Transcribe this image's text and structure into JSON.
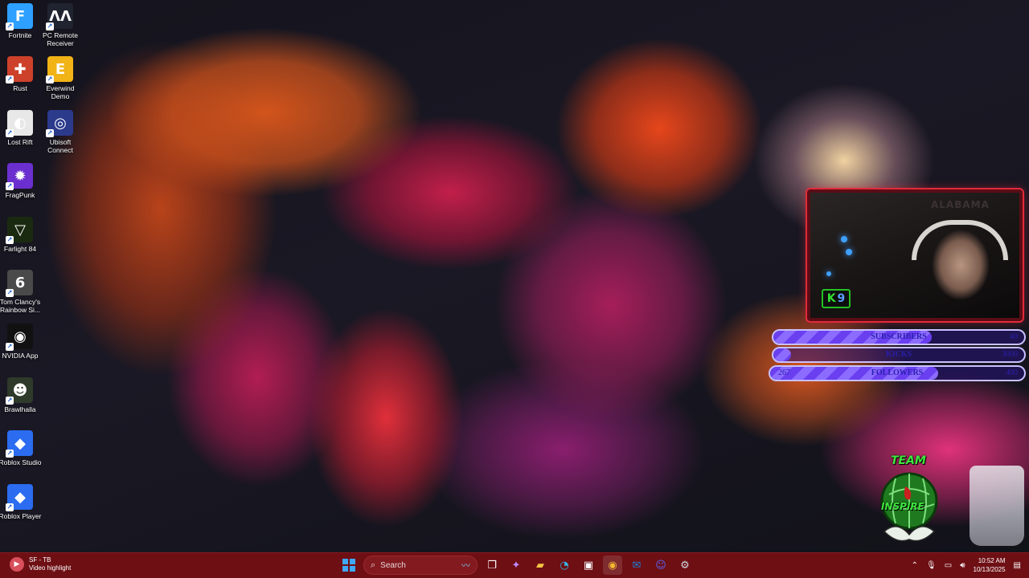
{
  "desktop": {
    "icons": [
      {
        "label": "Fortnite",
        "icon": "fortnite-icon",
        "glyph": "F",
        "color": "#2ea0ff"
      },
      {
        "label": "PC Remote Receiver",
        "icon": "pc-remote-icon",
        "glyph": "ΛΛ",
        "color": "#1f2430"
      },
      {
        "label": "Rust",
        "icon": "rust-icon",
        "glyph": "✚",
        "color": "#cd412b"
      },
      {
        "label": "Everwind Demo",
        "icon": "everwind-icon",
        "glyph": "E",
        "color": "#f1b316"
      },
      {
        "label": "Lost Rift",
        "icon": "lost-rift-icon",
        "glyph": "◐",
        "color": "#e8e8e8"
      },
      {
        "label": "Ubisoft Connect",
        "icon": "ubisoft-icon",
        "glyph": "◎",
        "color": "#2c3a8c"
      },
      {
        "label": "FragPunk",
        "icon": "fragpunk-icon",
        "glyph": "✹",
        "color": "#6b2fcf"
      },
      {
        "label": "Farlight 84",
        "icon": "farlight-icon",
        "glyph": "▽",
        "color": "#1a2a10"
      },
      {
        "label": "Tom Clancy's Rainbow Si...",
        "icon": "rainbow-six-icon",
        "glyph": "6",
        "color": "#4a4a4a"
      },
      {
        "label": "NVIDIA App",
        "icon": "nvidia-icon",
        "glyph": "◉",
        "color": "#111111"
      },
      {
        "label": "Brawlhalla",
        "icon": "brawlhalla-icon",
        "glyph": "☻",
        "color": "#2e3a2a"
      },
      {
        "label": "Roblox Studio",
        "icon": "roblox-studio-icon",
        "glyph": "◆",
        "color": "#2b6cf0"
      },
      {
        "label": "Roblox Player",
        "icon": "roblox-player-icon",
        "glyph": "◆",
        "color": "#2b6cf0"
      }
    ]
  },
  "overlay": {
    "cam_banner": "ALABAMA",
    "badge_letter": "K",
    "badge_number": "9",
    "goals": [
      {
        "current": "",
        "name": "SUBSCRIBERS",
        "target": "40",
        "progress": 0.63
      },
      {
        "current": "",
        "name": "KICKS",
        "target": "3000",
        "progress": 0.07
      },
      {
        "current": "267",
        "name": "FOLLOWERS",
        "target": "400",
        "progress": 0.66
      }
    ],
    "team_logo_top": "TEAM",
    "team_logo_bottom": "INSPIRE"
  },
  "taskbar": {
    "widget_title": "SF - TB",
    "widget_subtitle": "Video highlight",
    "search_placeholder": "Search",
    "apps": [
      {
        "name": "windows-start",
        "glyph": "▦",
        "color": "#3fa9ff",
        "active": false
      },
      {
        "name": "task-view",
        "glyph": "❐",
        "color": "#ffffff",
        "active": false
      },
      {
        "name": "copilot",
        "glyph": "✦",
        "color": "#c08cff",
        "active": false
      },
      {
        "name": "file-explorer",
        "glyph": "▰",
        "color": "#f4c542",
        "active": false
      },
      {
        "name": "edge",
        "glyph": "◔",
        "color": "#37b3e0",
        "active": false
      },
      {
        "name": "microsoft-store",
        "glyph": "▣",
        "color": "#ffffff",
        "active": false
      },
      {
        "name": "chrome",
        "glyph": "◉",
        "color": "#f2b632",
        "active": true
      },
      {
        "name": "outlook",
        "glyph": "✉",
        "color": "#1a7fd8",
        "active": false
      },
      {
        "name": "discord",
        "glyph": "☺",
        "color": "#5865f2",
        "active": false
      },
      {
        "name": "steam",
        "glyph": "⚙",
        "color": "#cfd6e0",
        "active": false
      }
    ],
    "time": "10:52 AM",
    "date": "10/13/2025"
  }
}
